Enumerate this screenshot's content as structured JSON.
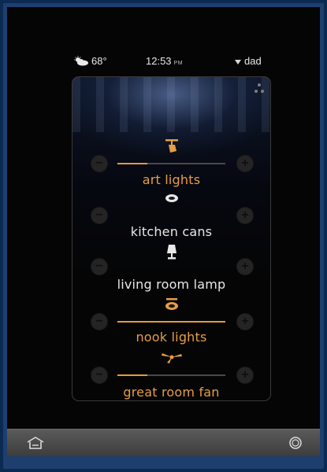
{
  "status": {
    "weather_icon": "partly-cloudy-icon",
    "temperature": "68°",
    "time": "12:53",
    "ampm": "PM",
    "user": "dad"
  },
  "devices": [
    {
      "name": "art lights",
      "icon": "track-spotlight-icon",
      "on": true,
      "level": 0.28
    },
    {
      "name": "kitchen cans",
      "icon": "recessed-can-icon",
      "on": false,
      "level": 0
    },
    {
      "name": "living room lamp",
      "icon": "table-lamp-icon",
      "on": false,
      "level": 0
    },
    {
      "name": "nook lights",
      "icon": "pendant-light-icon",
      "on": true,
      "level": 1.0
    },
    {
      "name": "great room fan",
      "icon": "ceiling-fan-icon",
      "on": true,
      "level": 0.28
    }
  ],
  "colors": {
    "accent": "#e79d44",
    "off_text": "#e8e8e8",
    "background": "#050505",
    "frame": "#1e3f6e"
  },
  "taskbar": {
    "home_icon": "home-icon",
    "settings_icon": "settings-ring-icon"
  }
}
